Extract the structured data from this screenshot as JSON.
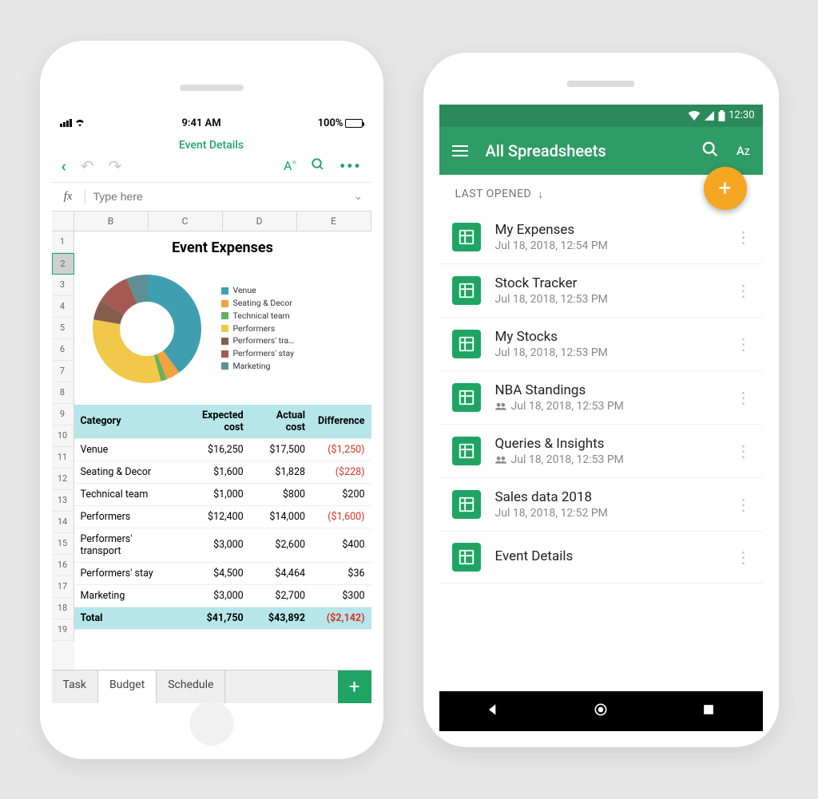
{
  "ios": {
    "status": {
      "time": "9:41 AM",
      "battery": "100%"
    },
    "doc_title": "Event Details",
    "formula_placeholder": "Type here",
    "columns": [
      "B",
      "C",
      "D",
      "E"
    ],
    "row_numbers": [
      "1",
      "2",
      "3",
      "4",
      "5",
      "6",
      "7",
      "8",
      "9",
      "10",
      "11",
      "12",
      "13",
      "14",
      "15",
      "16",
      "17",
      "18",
      "19"
    ],
    "chart_title": "Event Expenses",
    "table": {
      "headers": [
        "Category",
        "Expected cost",
        "Actual cost",
        "Difference"
      ],
      "rows": [
        {
          "cat": "Venue",
          "exp": "$16,250",
          "act": "$17,500",
          "diff": "($1,250)",
          "neg": true
        },
        {
          "cat": "Seating & Decor",
          "exp": "$1,600",
          "act": "$1,828",
          "diff": "($228)",
          "neg": true
        },
        {
          "cat": "Technical team",
          "exp": "$1,000",
          "act": "$800",
          "diff": "$200",
          "neg": false
        },
        {
          "cat": "Performers",
          "exp": "$12,400",
          "act": "$14,000",
          "diff": "($1,600)",
          "neg": true
        },
        {
          "cat": "Performers' transport",
          "exp": "$3,000",
          "act": "$2,600",
          "diff": "$400",
          "neg": false
        },
        {
          "cat": "Performers' stay",
          "exp": "$4,500",
          "act": "$4,464",
          "diff": "$36",
          "neg": false
        },
        {
          "cat": "Marketing",
          "exp": "$3,000",
          "act": "$2,700",
          "diff": "$300",
          "neg": false
        }
      ],
      "total": {
        "cat": "Total",
        "exp": "$41,750",
        "act": "$43,892",
        "diff": "($2,142)",
        "neg": true
      }
    },
    "tabs": [
      "Task",
      "Budget",
      "Schedule"
    ],
    "active_tab": 1
  },
  "android": {
    "status_time": "12:30",
    "appbar_title": "All Spreadsheets",
    "section_label": "LAST OPENED",
    "files": [
      {
        "name": "My Expenses",
        "sub": "Jul 18, 2018, 12:54 PM",
        "shared": false
      },
      {
        "name": "Stock Tracker",
        "sub": "Jul 18, 2018, 12:53 PM",
        "shared": false
      },
      {
        "name": "My Stocks",
        "sub": "Jul 18, 2018, 12:53 PM",
        "shared": false
      },
      {
        "name": "NBA Standings",
        "sub": "Jul 18, 2018, 12:53 PM",
        "shared": true
      },
      {
        "name": "Queries & Insights",
        "sub": "Jul 18, 2018, 12:53 PM",
        "shared": true
      },
      {
        "name": "Sales data 2018",
        "sub": "Jul 18, 2018, 12:52 PM",
        "shared": false
      },
      {
        "name": "Event Details",
        "sub": "",
        "shared": false
      }
    ]
  },
  "chart_data": {
    "type": "pie",
    "title": "Event Expenses",
    "series": [
      {
        "name": "Venue",
        "value": 17500,
        "color": "#3f9fb0"
      },
      {
        "name": "Seating & Decor",
        "value": 1828,
        "color": "#f0a33f"
      },
      {
        "name": "Technical team",
        "value": 800,
        "color": "#6aaf5f"
      },
      {
        "name": "Performers",
        "value": 14000,
        "color": "#f2c84b"
      },
      {
        "name": "Performers' tra…",
        "value": 2600,
        "color": "#855d4c"
      },
      {
        "name": "Performers' stay",
        "value": 4464,
        "color": "#a45a52"
      },
      {
        "name": "Marketing",
        "value": 2700,
        "color": "#5f8f92"
      }
    ]
  }
}
